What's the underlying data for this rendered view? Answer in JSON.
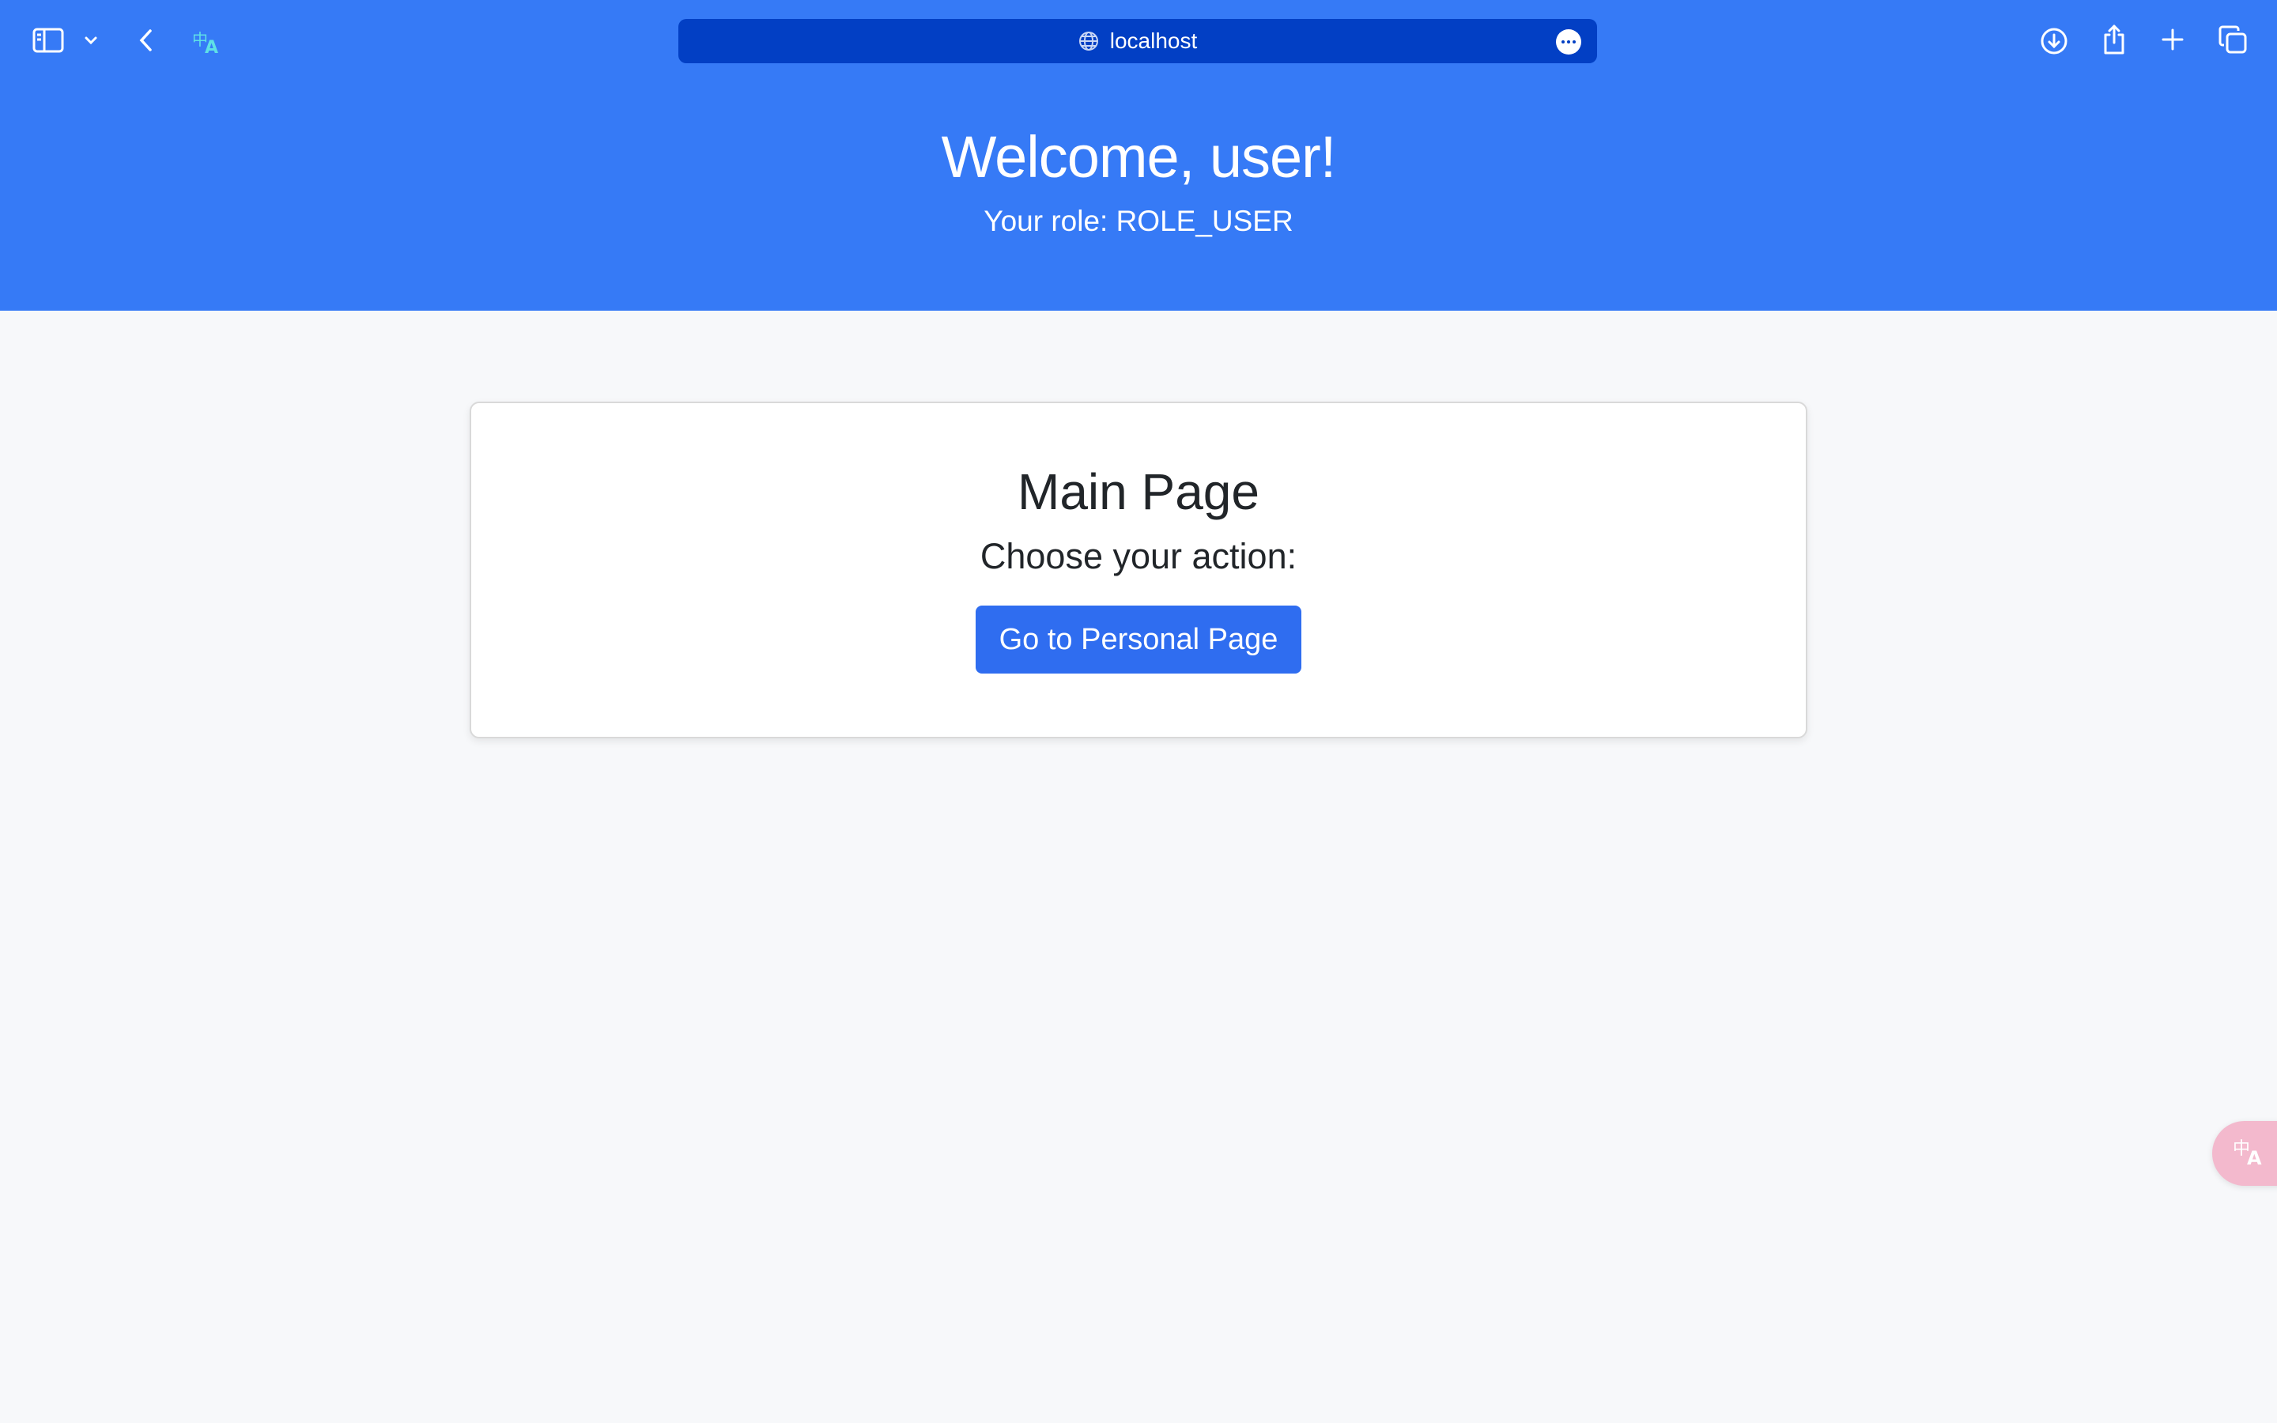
{
  "browser": {
    "address": "localhost",
    "icons": {
      "sidebar": "sidebar-icon",
      "sidebar_menu": "chevron-down-icon",
      "back": "chevron-left-icon",
      "translate": "translate-icon",
      "site": "globe-icon",
      "more": "more-icon",
      "download": "download-icon",
      "share": "share-icon",
      "new_tab": "plus-icon",
      "tabs": "tab-overview-icon"
    }
  },
  "header": {
    "title": "Welcome, user!",
    "role_text": "Your role: ROLE_USER"
  },
  "main": {
    "title": "Main Page",
    "subtitle": "Choose your action:",
    "button_label": "Go to Personal Page"
  },
  "colors": {
    "header_blue": "#367af6",
    "address_bar": "#023fc4",
    "button": "#2f6df0",
    "page_bg": "#f7f8fa"
  }
}
